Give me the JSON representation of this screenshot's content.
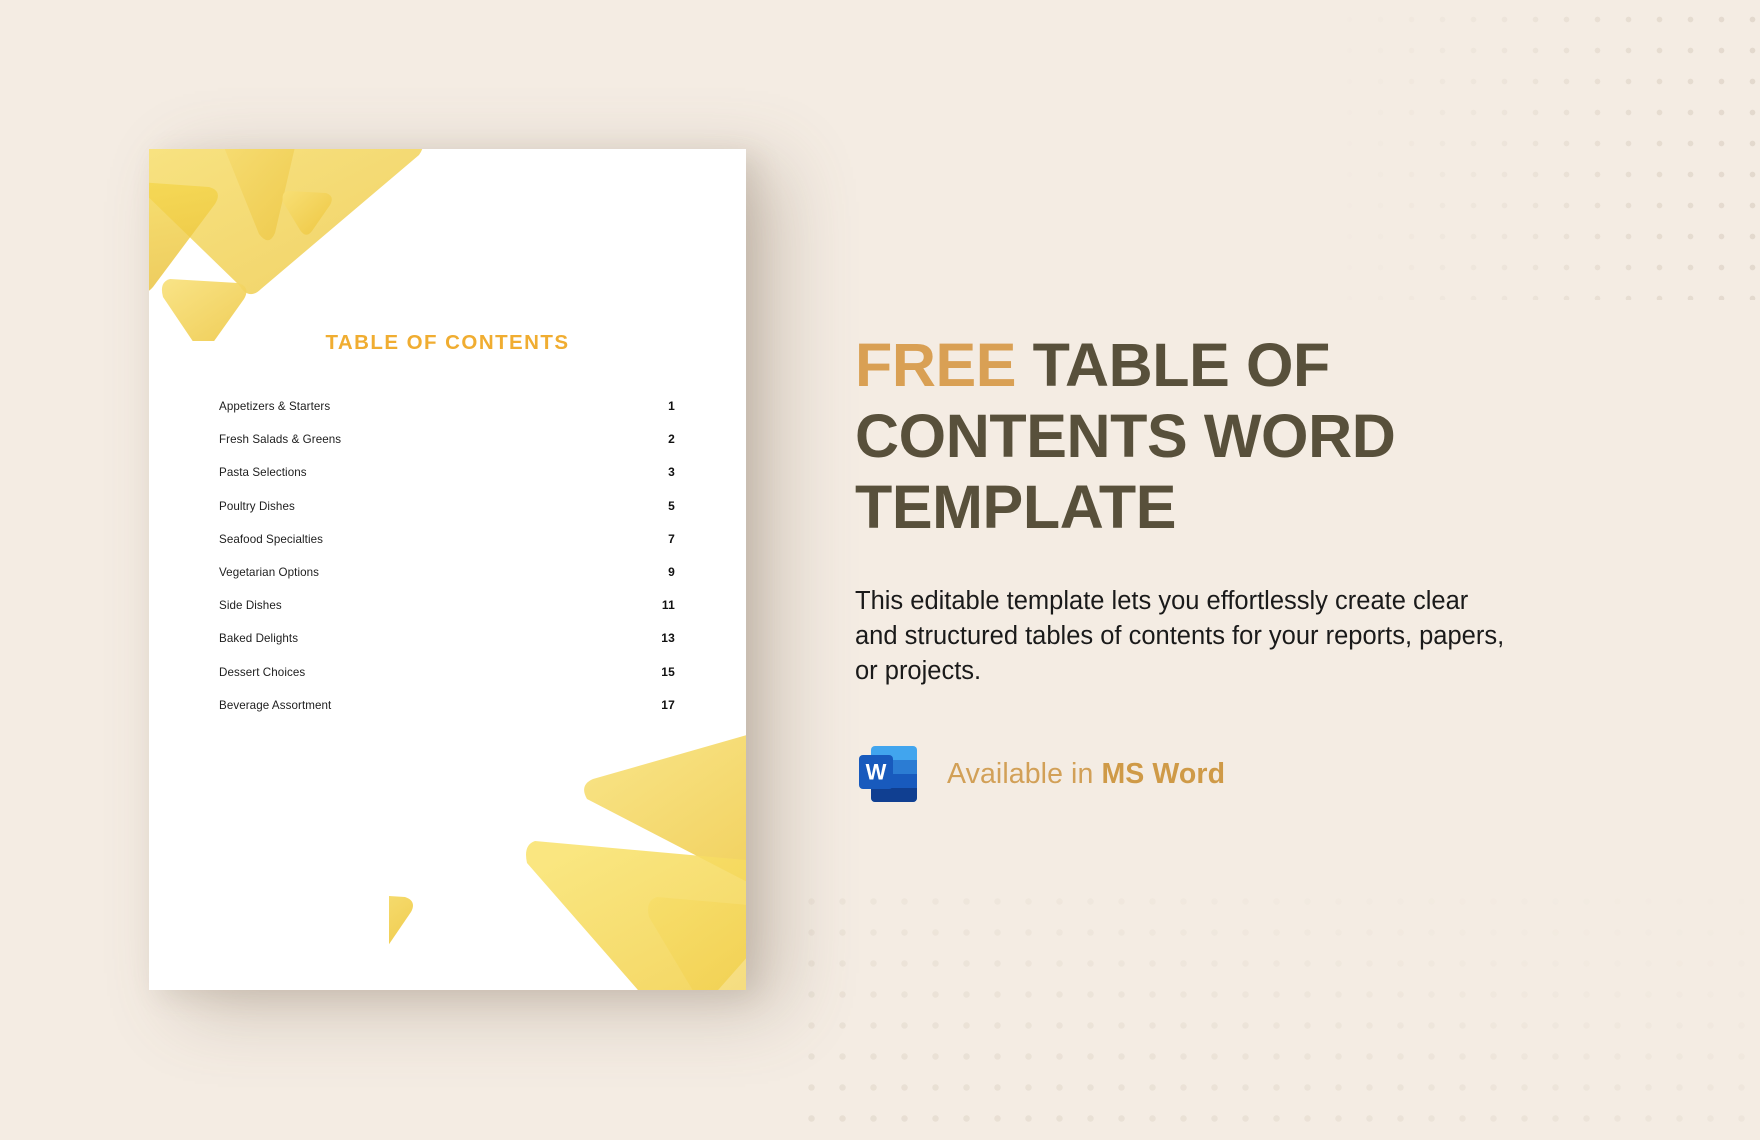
{
  "background": {
    "color": "#f4ece3",
    "dot_color": "#e3d9cd"
  },
  "document": {
    "page_background": "#ffffff",
    "title": "TABLE OF CONTENTS",
    "title_color": "#f0ad31",
    "accent_shape_color": "#f5d34f",
    "entries": [
      {
        "label": "Appetizers & Starters",
        "page": "1"
      },
      {
        "label": "Fresh Salads & Greens",
        "page": "2"
      },
      {
        "label": "Pasta Selections",
        "page": "3"
      },
      {
        "label": "Poultry Dishes",
        "page": "5"
      },
      {
        "label": "Seafood Specialties",
        "page": "7"
      },
      {
        "label": "Vegetarian Options",
        "page": "9"
      },
      {
        "label": "Side Dishes",
        "page": "11"
      },
      {
        "label": "Baked Delights",
        "page": "13"
      },
      {
        "label": "Dessert Choices",
        "page": "15"
      },
      {
        "label": "Beverage Assortment",
        "page": "17"
      }
    ]
  },
  "promo": {
    "headline_accent": "FREE",
    "headline_rest": " TABLE OF CONTENTS WORD TEMPLATE",
    "headline_accent_color": "#d9a054",
    "headline_color": "#58503b",
    "description": "This editable template lets you effortlessly create clear and structured tables of contents for your reports, papers, or projects.",
    "availability_prefix": "Available in ",
    "availability_app": "MS Word",
    "availability_color": "#d2a057",
    "word_icon_letter": "W",
    "word_icon_colors": {
      "light": "#41a5ee",
      "mid": "#2b7cd3",
      "dark": "#185abd",
      "darkest": "#103f91"
    }
  }
}
